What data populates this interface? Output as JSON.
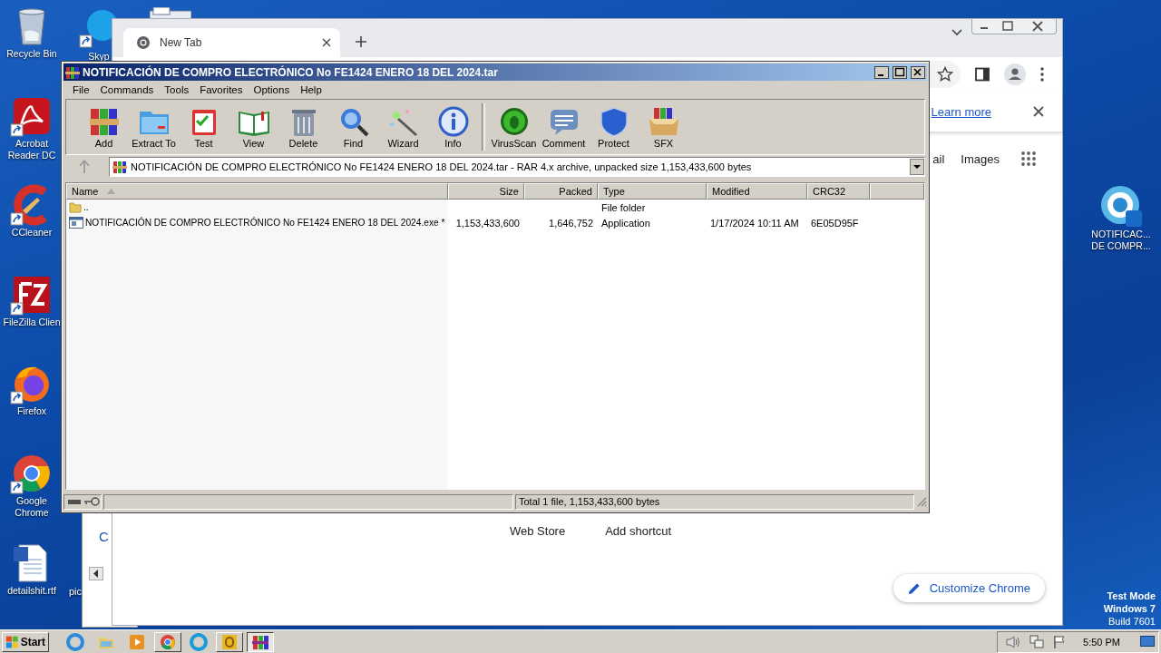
{
  "desktop": {
    "icons": [
      {
        "label": "Recycle Bin",
        "kind": "recycle",
        "shortcut": false
      },
      {
        "label": "Acrobat Reader DC",
        "kind": "acrobat",
        "shortcut": true
      },
      {
        "label": "CCleaner",
        "kind": "ccleaner",
        "shortcut": true
      },
      {
        "label": "FileZilla Clien",
        "kind": "filezilla",
        "shortcut": true
      },
      {
        "label": "Firefox",
        "kind": "firefox",
        "shortcut": true
      },
      {
        "label": "Google Chrome",
        "kind": "chrome",
        "shortcut": true
      },
      {
        "label": "detailshit.rtf",
        "kind": "word",
        "shortcut": false
      }
    ],
    "second_column": [
      {
        "label": "Skyp",
        "kind": "skype",
        "shortcut": true
      }
    ],
    "hidden_label": "pic",
    "right_icon": {
      "label": "NOTIFICAC... DE COMPR...",
      "kind": "notif"
    },
    "system_note": [
      "Test Mode",
      "Windows 7",
      "Build 7601"
    ]
  },
  "back_window": {
    "text": "C"
  },
  "browser": {
    "tabs": [
      {
        "label": "New Tab",
        "selected": true
      }
    ],
    "infobar": {
      "link": "Learn more"
    },
    "top_links": [
      "ail",
      "Images"
    ],
    "shortcuts": [
      "Web Store",
      "Add shortcut"
    ],
    "customize_button": "Customize Chrome"
  },
  "winrar": {
    "title": "NOTIFICACIÓN DE COMPRO ELECTRÓNICO No FE1424 ENERO 18 DEL 2024.tar",
    "menu": [
      "File",
      "Commands",
      "Tools",
      "Favorites",
      "Options",
      "Help"
    ],
    "toolbar": [
      {
        "label": "Add",
        "kind": "add"
      },
      {
        "label": "Extract To",
        "kind": "extract"
      },
      {
        "label": "Test",
        "kind": "test"
      },
      {
        "label": "View",
        "kind": "view"
      },
      {
        "label": "Delete",
        "kind": "delete"
      },
      {
        "label": "Find",
        "kind": "find"
      },
      {
        "label": "Wizard",
        "kind": "wizard"
      },
      {
        "label": "Info",
        "kind": "info"
      },
      {
        "label": "VirusScan",
        "kind": "virus"
      },
      {
        "label": "Comment",
        "kind": "comment"
      },
      {
        "label": "Protect",
        "kind": "protect"
      },
      {
        "label": "SFX",
        "kind": "sfx"
      }
    ],
    "path": "NOTIFICACIÓN DE COMPRO ELECTRÓNICO No FE1424 ENERO 18 DEL 2024.tar - RAR 4.x archive, unpacked size 1,153,433,600 bytes",
    "columns": [
      {
        "label": "Name",
        "sorted": true
      },
      {
        "label": "Size",
        "sorted": false
      },
      {
        "label": "Packed",
        "sorted": false
      },
      {
        "label": "Type",
        "sorted": false
      },
      {
        "label": "Modified",
        "sorted": false
      },
      {
        "label": "CRC32",
        "sorted": false
      }
    ],
    "rows": [
      {
        "kind": "folder",
        "name": "..",
        "type": "File folder"
      },
      {
        "kind": "exe",
        "name": "NOTIFICACIÓN DE COMPRO ELECTRÓNICO No FE1424 ENERO 18 DEL 2024.exe *",
        "size": "1,153,433,600",
        "packed": "1,646,752",
        "type": "Application",
        "modified": "1/17/2024 10:11 AM",
        "crc32": "6E05D95F"
      }
    ],
    "status": "Total 1 file, 1,153,433,600 bytes"
  },
  "taskbar": {
    "start": "Start",
    "apps": [
      {
        "kind": "ie",
        "running": false,
        "selected": false
      },
      {
        "kind": "explorer",
        "running": false,
        "selected": false
      },
      {
        "kind": "media",
        "running": false,
        "selected": false
      },
      {
        "kind": "chrome",
        "running": true,
        "selected": false
      },
      {
        "kind": "edge",
        "running": false,
        "selected": false
      },
      {
        "kind": "outlook",
        "running": true,
        "selected": false
      },
      {
        "kind": "winrar",
        "running": true,
        "selected": true
      }
    ],
    "clock": "5:50 PM"
  }
}
